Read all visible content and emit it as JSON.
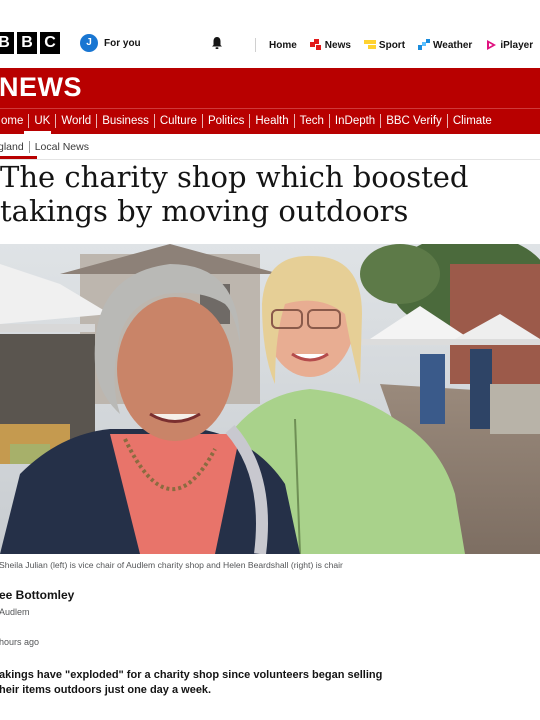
{
  "header": {
    "logo_letters": [
      "B",
      "B",
      "C"
    ],
    "for_you_badge": "J",
    "for_you_label": "For you",
    "nav": [
      {
        "label": "Home",
        "icon": "home"
      },
      {
        "label": "News",
        "icon": "news-icon",
        "color": "#e21b1b"
      },
      {
        "label": "Sport",
        "icon": "sport-icon",
        "color": "#ffd230"
      },
      {
        "label": "Weather",
        "icon": "weather-icon",
        "color": "#1a8cdc"
      },
      {
        "label": "iPlayer",
        "icon": "iplayer-icon",
        "color": "#e0117f"
      }
    ]
  },
  "section": {
    "title": "NEWS",
    "brand_color": "#b80000",
    "nav": [
      "ome",
      "UK",
      "World",
      "Business",
      "Culture",
      "Politics",
      "Health",
      "Tech",
      "InDepth",
      "BBC Verify",
      "Climate"
    ],
    "active": "UK"
  },
  "subnav": {
    "items": [
      "gland",
      "Local News"
    ],
    "active": "gland"
  },
  "article": {
    "headline_line1": "The charity shop which boosted",
    "headline_line2": "takings by moving outdoors",
    "caption": "Sheila Julian (left) is vice chair of Audlem charity shop and Helen Beardshall (right) is chair",
    "author": "ee Bottomley",
    "author_place": "Audlem",
    "timestamp": "hours ago",
    "summary_line1": "akings have \"exploded\" for a charity shop since volunteers began selling",
    "summary_line2": "heir items outdoors just one day a week."
  }
}
